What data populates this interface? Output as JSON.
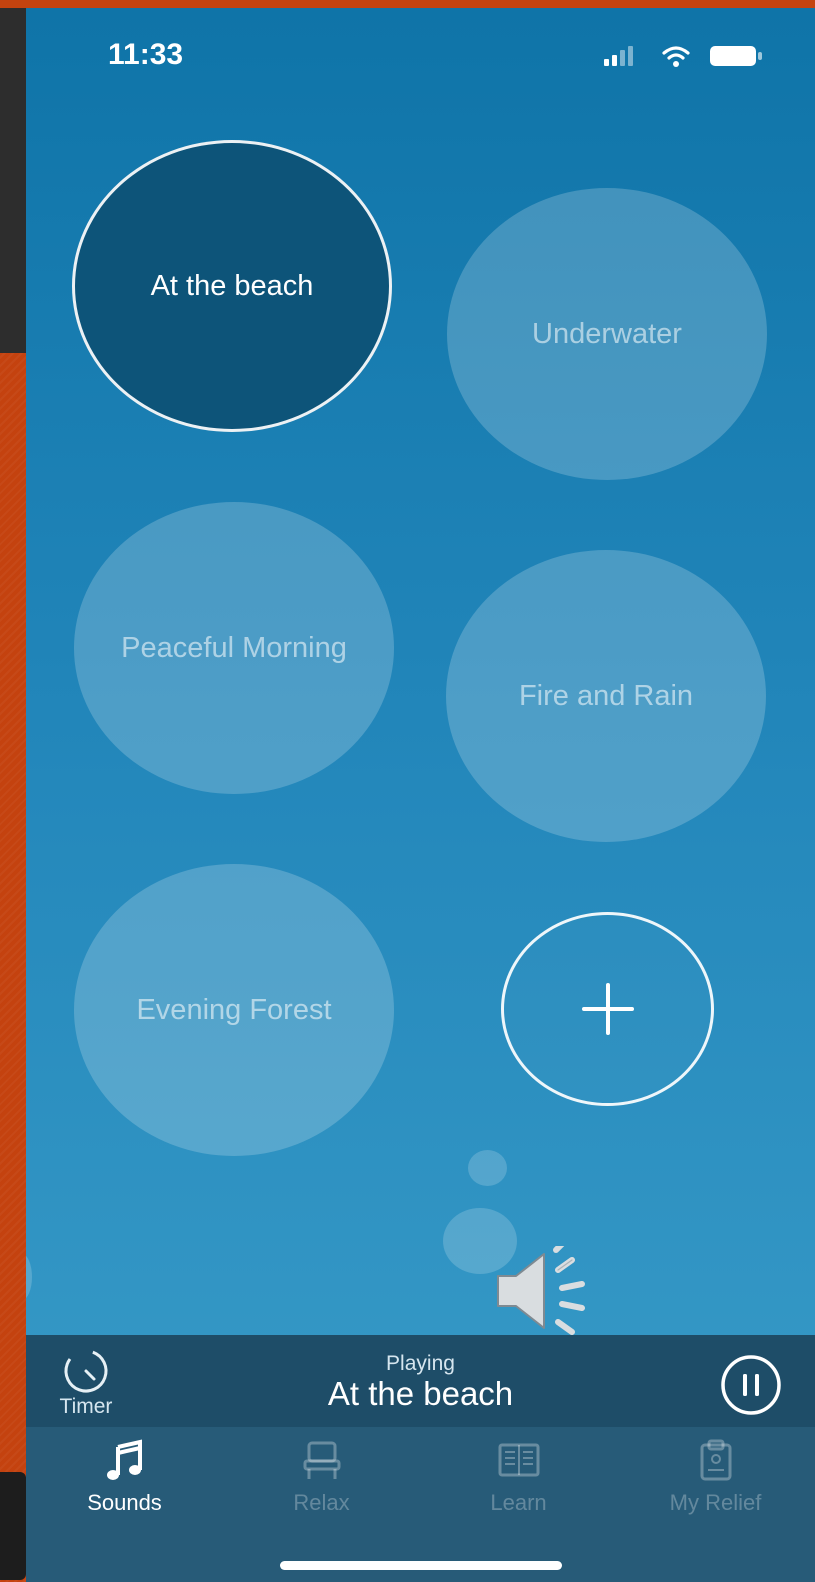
{
  "status_bar": {
    "time": "11:33",
    "icons": [
      "signal-icon",
      "wifi-icon",
      "battery-icon"
    ]
  },
  "sounds": [
    {
      "label": "At the beach",
      "active": true
    },
    {
      "label": "Underwater",
      "active": false
    },
    {
      "label": "Peaceful Morning",
      "active": false
    },
    {
      "label": "Fire and Rain",
      "active": false
    },
    {
      "label": "Evening Forest",
      "active": false
    }
  ],
  "add_button": {
    "icon": "plus-icon"
  },
  "now_playing": {
    "timer_label": "Timer",
    "status_label": "Playing",
    "title": "At the beach",
    "control_icon": "pause-icon"
  },
  "tabs": [
    {
      "label": "Sounds",
      "icon": "music-note-icon",
      "active": true
    },
    {
      "label": "Relax",
      "icon": "chair-icon",
      "active": false
    },
    {
      "label": "Learn",
      "icon": "book-icon",
      "active": false
    },
    {
      "label": "My Relief",
      "icon": "clipboard-icon",
      "active": false
    }
  ],
  "colors": {
    "accent_bg": "#1e4d68",
    "tab_bar_bg": "#275b78",
    "active_bubble": "#0d5479",
    "frame_orange": "#c4420f"
  }
}
